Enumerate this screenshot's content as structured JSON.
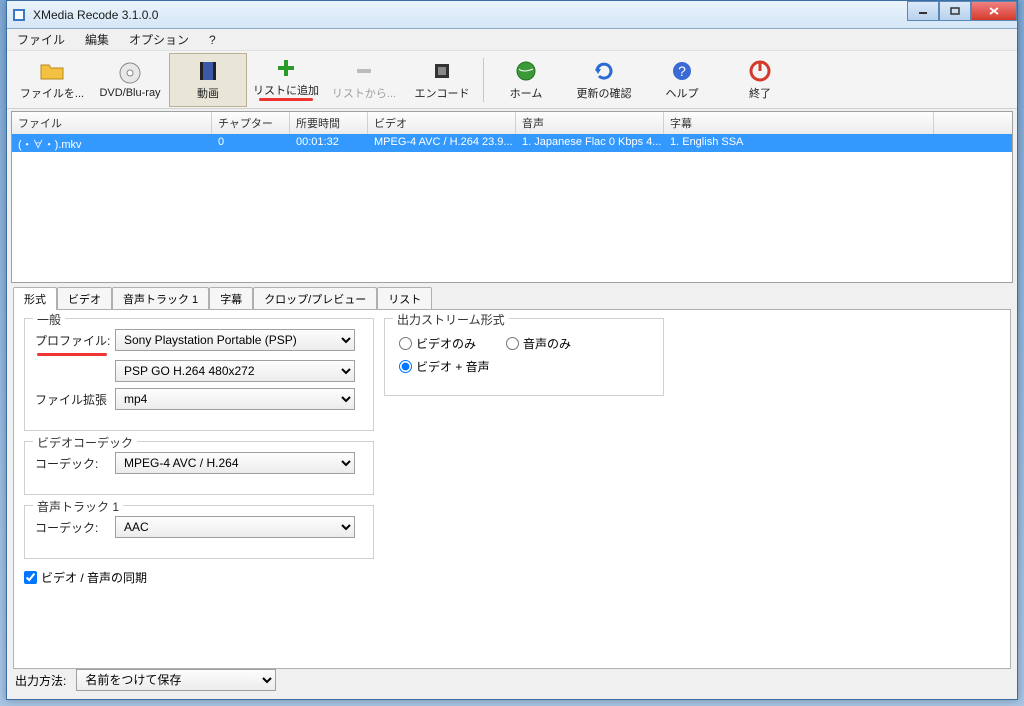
{
  "window": {
    "title": "XMedia Recode 3.1.0.0"
  },
  "menu": {
    "file": "ファイル",
    "edit": "編集",
    "options": "オプション",
    "help": "?"
  },
  "toolbar": {
    "open": "ファイルを...",
    "disc": "DVD/Blu-ray",
    "video": "動画",
    "addlist": "リストに追加",
    "removelist": "リストから...",
    "encode": "エンコード",
    "home": "ホーム",
    "update": "更新の確認",
    "helpbtn": "ヘルプ",
    "exit": "終了"
  },
  "filelist": {
    "headers": {
      "file": "ファイル",
      "chapter": "チャプター",
      "time": "所要時間",
      "video": "ビデオ",
      "audio": "音声",
      "sub": "字幕"
    },
    "rows": [
      {
        "file": "(・∀・).mkv",
        "chapter": "0",
        "time": "00:01:32",
        "video": "MPEG-4 AVC / H.264 23.9...",
        "audio": "1. Japanese Flac 0 Kbps 4...",
        "sub": "1. English SSA"
      }
    ]
  },
  "tabs": {
    "format": "形式",
    "video": "ビデオ",
    "audio1": "音声トラック 1",
    "sub": "字幕",
    "crop": "クロップ/プレビュー",
    "list": "リスト"
  },
  "format": {
    "general_title": "一般",
    "profile_label": "プロファイル:",
    "profile_value": "Sony Playstation Portable (PSP)",
    "sub_profile_value": "PSP GO H.264 480x272",
    "ext_label": "ファイル拡張",
    "ext_value": "mp4",
    "videocodec_title": "ビデオコーデック",
    "codec_label": "コーデック:",
    "video_codec_value": "MPEG-4 AVC / H.264",
    "audiotrack_title": "音声トラック 1",
    "audio_codec_value": "AAC",
    "sync_label": "ビデオ / 音声の同期",
    "stream_title": "出力ストリーム形式",
    "video_only": "ビデオのみ",
    "audio_only": "音声のみ",
    "video_audio": "ビデオ + 音声"
  },
  "footer": {
    "label": "出力方法:",
    "value": "名前をつけて保存"
  }
}
